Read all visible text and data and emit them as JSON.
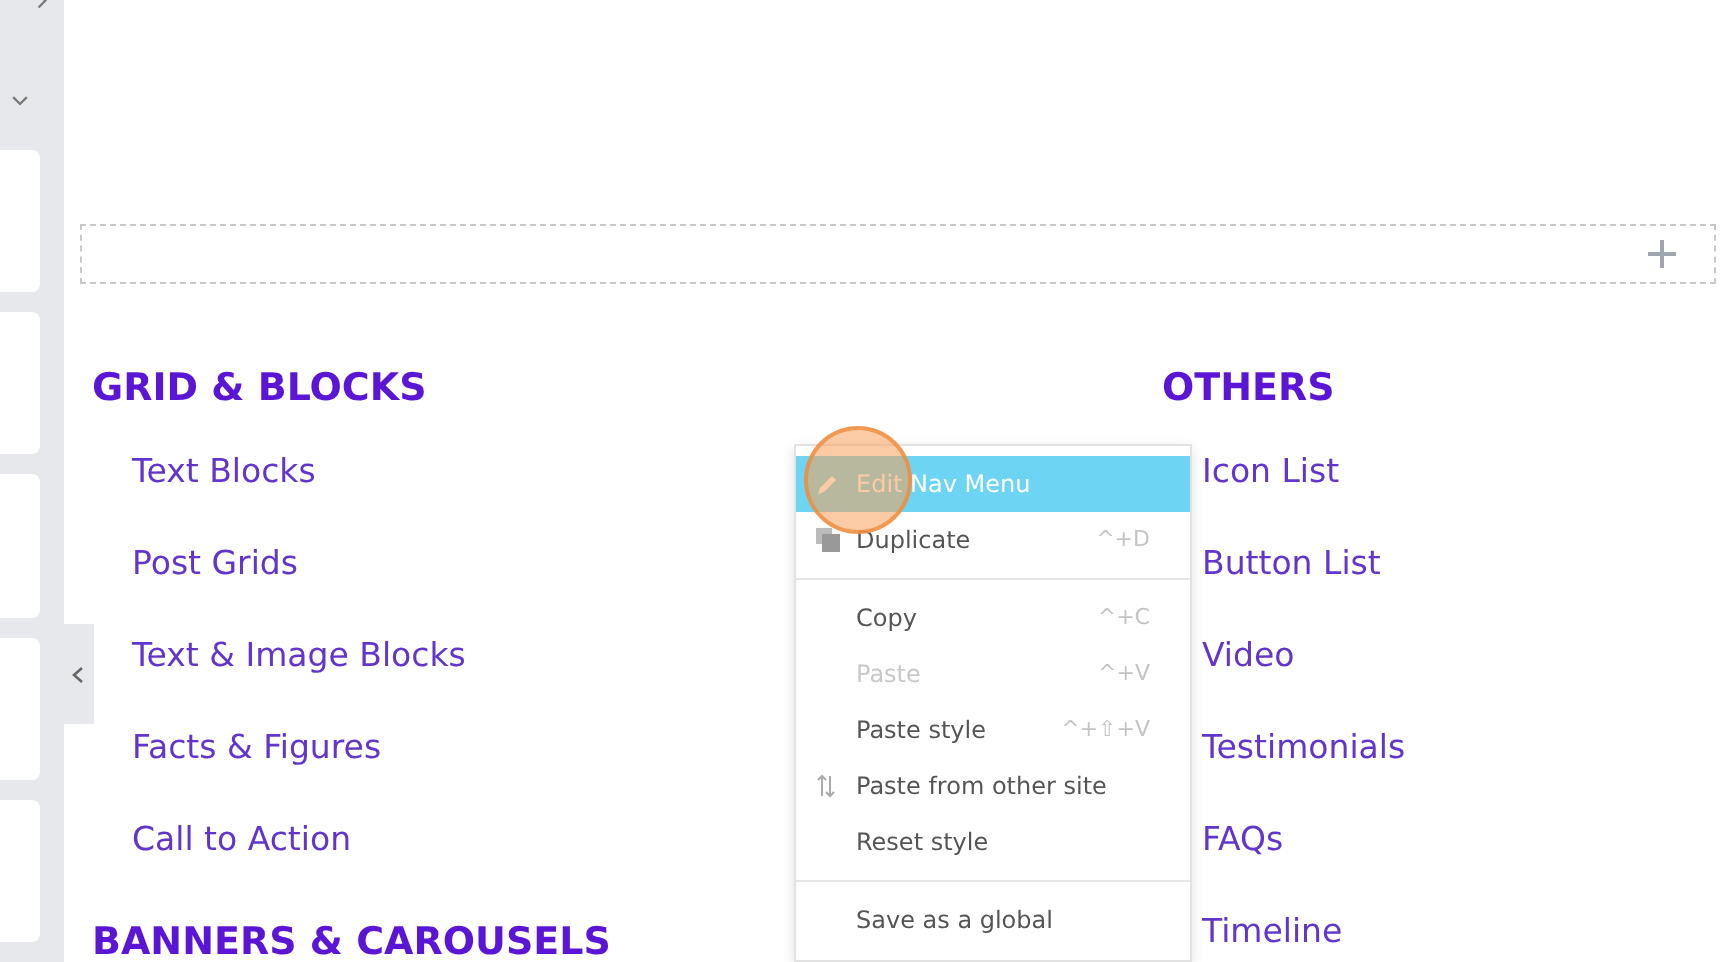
{
  "sections": [
    {
      "heading": "GRID & BLOCKS",
      "items": [
        "Text Blocks",
        "Post Grids",
        "Text & Image Blocks",
        "Facts & Figures",
        "Call to Action"
      ]
    },
    {
      "heading": "OTHERS",
      "items": [
        "Icon List",
        "Button List",
        "Video",
        "Testimonials",
        "FAQs",
        "Timeline"
      ]
    }
  ],
  "next_heading": "BANNERS & CAROUSELS",
  "context_menu": [
    {
      "kind": "item",
      "label": "Edit Nav Menu",
      "selected": true,
      "disabled": false
    },
    {
      "kind": "item",
      "label": "Duplicate",
      "shortcut": "^+D",
      "selected": false,
      "disabled": false
    },
    {
      "kind": "divider"
    },
    {
      "kind": "item",
      "label": "Copy",
      "shortcut": "^+C",
      "selected": false,
      "disabled": false
    },
    {
      "kind": "item",
      "label": "Paste",
      "shortcut": "^+V",
      "selected": false,
      "disabled": true
    },
    {
      "kind": "item",
      "label": "Paste style",
      "shortcut": "^+⇧+V",
      "selected": false,
      "disabled": false
    },
    {
      "kind": "item",
      "label": "Paste from other site",
      "selected": false,
      "disabled": false
    },
    {
      "kind": "item",
      "label": "Reset style",
      "selected": false,
      "disabled": false
    },
    {
      "kind": "divider"
    },
    {
      "kind": "item",
      "label": "Save as a global",
      "selected": false,
      "disabled": false
    }
  ]
}
